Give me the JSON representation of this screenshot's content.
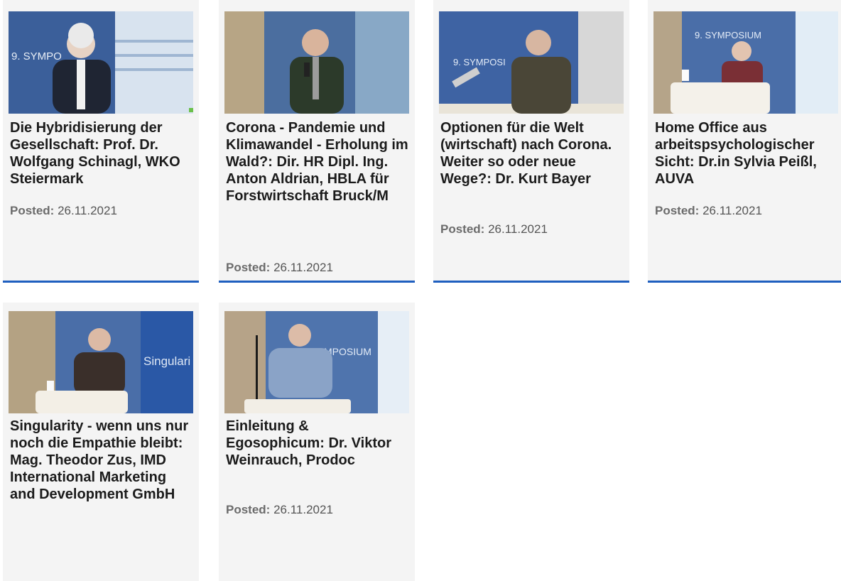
{
  "posted_label": "Posted:",
  "accent_color": "#1f5fbf",
  "cards": [
    {
      "title": "Die Hybridisierung der Gesellschaft: Prof. Dr. Wolfgang Schinagl, WKO Steiermark",
      "date": "26.11.2021",
      "thumb_text": "9. SYMPO"
    },
    {
      "title": "Corona - Pandemie und Klimawandel - Erholung im Wald?: Dir. HR Dipl. Ing. Anton Aldrian, HBLA für Forstwirtschaft Bruck/M",
      "date": "26.11.2021",
      "thumb_text": ""
    },
    {
      "title": "Optionen für die Welt (wirtschaft) nach Corona. Weiter so oder neue Wege?: Dr. Kurt Bayer",
      "date": "26.11.2021",
      "thumb_text": "9. SYMPOSI"
    },
    {
      "title": "Home Office aus arbeitspsychologischer Sicht: Dr.in Sylvia Peißl, AUVA",
      "date": "26.11.2021",
      "thumb_text": "9. SYMPOSIUM"
    },
    {
      "title": "Singularity - wenn uns nur noch die Empathie bleibt: Mag. Theodor Zus, IMD International Marketing and Development GmbH",
      "date": "",
      "thumb_text": "Singulari"
    },
    {
      "title": "Einleitung & Egosophicum: Dr. Viktor Weinrauch, Prodoc",
      "date": "26.11.2021",
      "thumb_text": "MPOSIUM"
    }
  ]
}
